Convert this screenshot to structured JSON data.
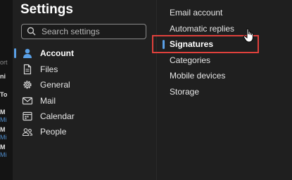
{
  "background_app": {
    "fragments": [
      "ort",
      "ni",
      "To",
      "M",
      "Mi",
      "M",
      "Mi",
      "M",
      "Mi"
    ]
  },
  "settings": {
    "title": "Settings",
    "search": {
      "placeholder": "Search settings",
      "icon": "search-icon"
    },
    "nav": [
      {
        "label": "Account",
        "icon": "person-icon",
        "selected": true
      },
      {
        "label": "Files",
        "icon": "file-icon",
        "selected": false
      },
      {
        "label": "General",
        "icon": "gear-icon",
        "selected": false
      },
      {
        "label": "Mail",
        "icon": "mail-icon",
        "selected": false
      },
      {
        "label": "Calendar",
        "icon": "calendar-icon",
        "selected": false
      },
      {
        "label": "People",
        "icon": "people-icon",
        "selected": false
      }
    ]
  },
  "account_submenu": {
    "items": [
      {
        "label": "Email account",
        "selected": false
      },
      {
        "label": "Automatic replies",
        "selected": false
      },
      {
        "label": "Signatures",
        "selected": true
      },
      {
        "label": "Categories",
        "selected": false
      },
      {
        "label": "Mobile devices",
        "selected": false
      },
      {
        "label": "Storage",
        "selected": false
      }
    ]
  },
  "colors": {
    "accent": "#5aa0e6",
    "highlight": "#e0413c",
    "panel_bg": "#202020"
  }
}
